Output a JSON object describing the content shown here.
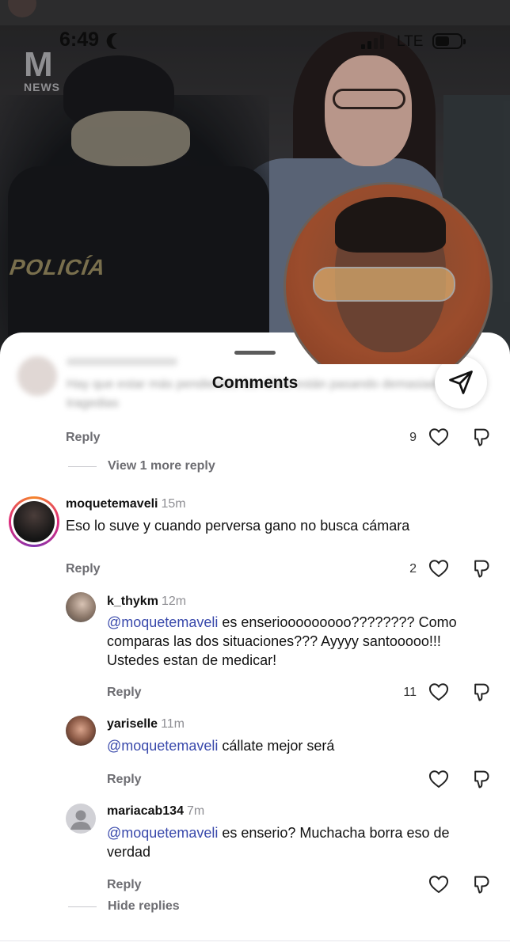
{
  "status_bar": {
    "time": "6:49",
    "network": "LTE"
  },
  "video": {
    "logo_letter": "M",
    "logo_sub": "NEWS",
    "police_text": "POLICÍA"
  },
  "sheet": {
    "title": "Comments"
  },
  "blurred_comment": {
    "text": "Hay que estar más pendientes los niños están pasando demasiadas tragedias",
    "reply_label": "Reply",
    "likes": "9",
    "view_more_label": "View 1 more reply"
  },
  "comments": [
    {
      "username": "moquetemaveli",
      "time": "15m",
      "text": "Eso lo suve y cuando perversa gano no busca cámara",
      "reply_label": "Reply",
      "likes": "2"
    }
  ],
  "replies": [
    {
      "username": "k_thykm",
      "time": "12m",
      "mention": "@moquetemaveli",
      "text": " es enseriooooooooo???????? Como comparas las dos situaciones??? Ayyyy santooooo!!! Ustedes estan de medicar!",
      "reply_label": "Reply",
      "likes": "11"
    },
    {
      "username": "yariselle",
      "time": "11m",
      "mention": "@moquetemaveli",
      "text": " cállate mejor será",
      "reply_label": "Reply",
      "likes": ""
    },
    {
      "username": "mariacab134",
      "time": "7m",
      "mention": "@moquetemaveli",
      "text": " es enserio? Muchacha borra eso de verdad",
      "reply_label": "Reply",
      "likes": ""
    }
  ],
  "hide_replies_label": "Hide replies",
  "colors": {
    "mention": "#3949ab",
    "muted": "#6d6d72",
    "story_ring_start": "#f58529",
    "story_ring_end": "#8134af"
  }
}
